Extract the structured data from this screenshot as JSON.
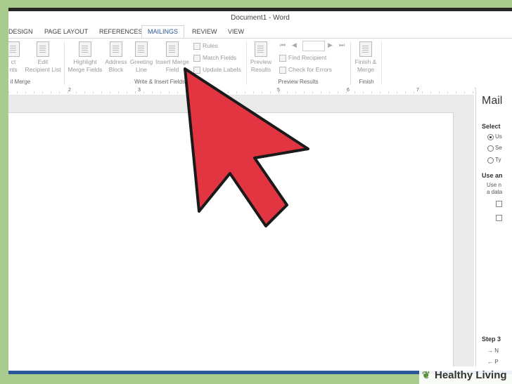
{
  "window": {
    "title": "Document1 - Word"
  },
  "tabs": [
    "DESIGN",
    "PAGE LAYOUT",
    "REFERENCES",
    "MAILINGS",
    "REVIEW",
    "VIEW"
  ],
  "ribbon": {
    "start_merge": {
      "line1": "ct",
      "line2": "nts",
      "group": "il Merge"
    },
    "edit_recipient": {
      "line1": "Edit",
      "line2": "Recipient List"
    },
    "highlight": {
      "line1": "Highlight",
      "line2": "Merge Fields"
    },
    "address_block": {
      "line1": "Address",
      "line2": "Block"
    },
    "greeting_line": {
      "line1": "Greeting",
      "line2": "Line"
    },
    "insert_merge": {
      "line1": "Insert Merge",
      "line2": "Field"
    },
    "rules": "Rules",
    "match_fields": "Match Fields",
    "update_labels": "Update Labels",
    "write_group": "Write & Insert Fields",
    "preview_results": {
      "line1": "Preview",
      "line2": "Results"
    },
    "find_recipient": "Find Recipient",
    "check_errors": "Check for Errors",
    "preview_group": "Preview Results",
    "finish_merge": {
      "line1": "Finish &",
      "line2": "Merge"
    },
    "finish_group": "Finish"
  },
  "ruler": {
    "marks": [
      "2",
      "3",
      "4",
      "5",
      "6",
      "7"
    ]
  },
  "pane": {
    "title": "Mail",
    "select_label": "Select",
    "options": [
      "Us",
      "Se",
      "Ty"
    ],
    "use_label": "Use an",
    "use_text1": "Use n",
    "use_text2": "a data",
    "step_label": "Step 3",
    "next": "N",
    "prev": "P"
  },
  "watermark": {
    "icon": "leaf-icon",
    "text": "Healthy Living"
  },
  "colors": {
    "arrow": "#e23441",
    "background": "#a9cc8e",
    "accent": "#2b579a"
  }
}
